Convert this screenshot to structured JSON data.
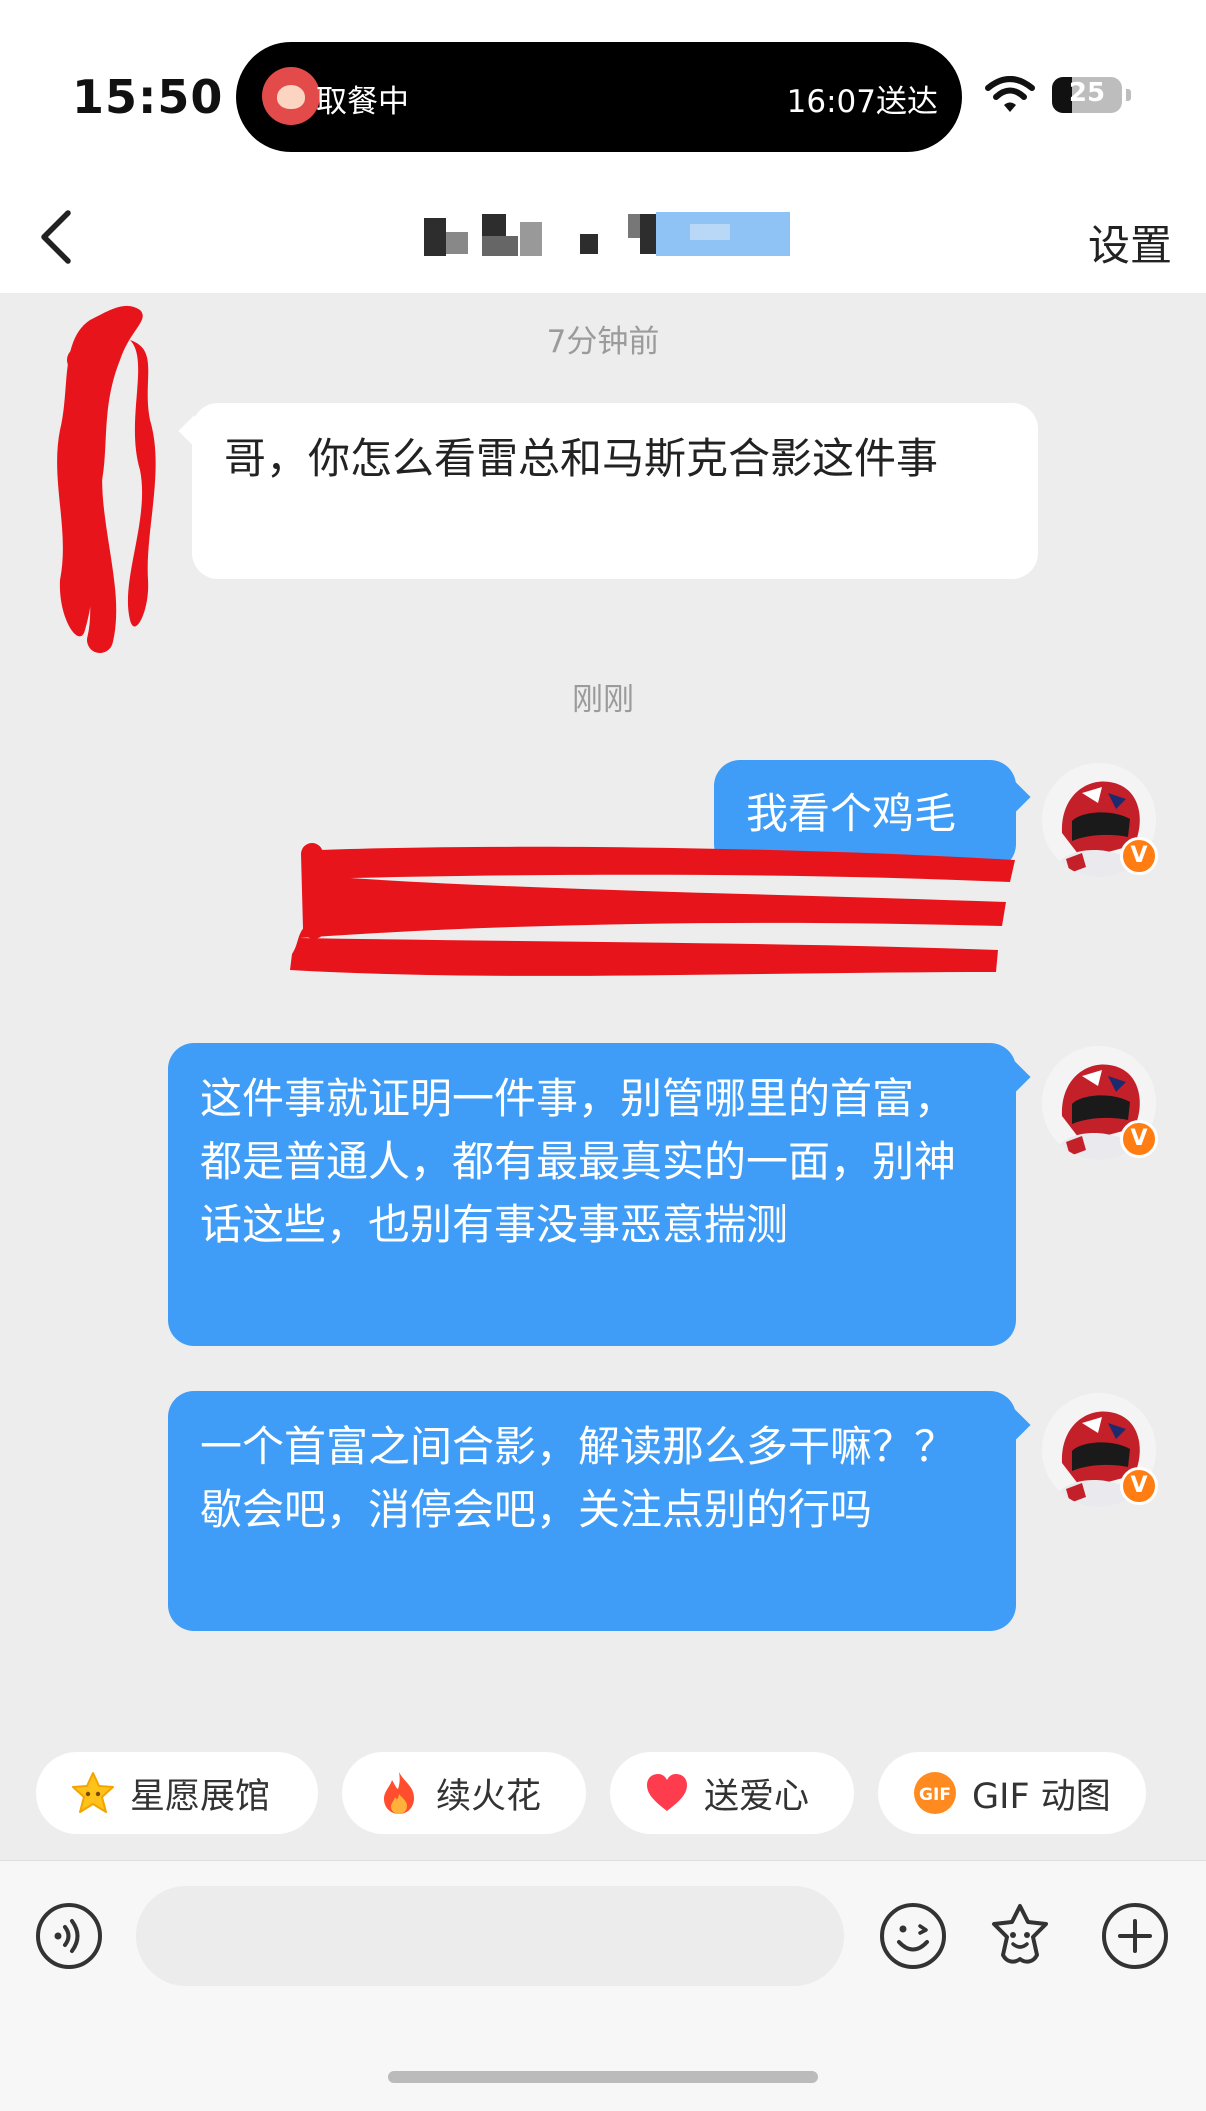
{
  "status_bar": {
    "time": "15:50",
    "live_activity": {
      "left_text": "取餐中",
      "right_text": "16:07送达"
    },
    "battery": "25"
  },
  "header": {
    "back_icon": "chevron-left-icon",
    "settings_label": "设置"
  },
  "messages": [
    {
      "type": "timestamp",
      "text": "7分钟前"
    },
    {
      "type": "incoming",
      "text": "哥，你怎么看雷总和马斯克合影这件事"
    },
    {
      "type": "timestamp",
      "text": "刚刚"
    },
    {
      "type": "outgoing",
      "text": "我看个鸡毛"
    },
    {
      "type": "outgoing",
      "text": "这件事就证明一件事，别管哪里的首富，都是普通人，都有最最真实的一面，别神话这些，也别有事没事恶意揣测"
    },
    {
      "type": "outgoing",
      "text": "一个首富之间合影，解读那么多干嘛？？歇会吧，消停会吧，关注点别的行吗"
    }
  ],
  "quick_actions": [
    {
      "label": "星愿展馆",
      "icon": "star-face-icon"
    },
    {
      "label": "续火花",
      "icon": "fire-icon"
    },
    {
      "label": "送爱心",
      "icon": "heart-icon"
    },
    {
      "label": "GIF 动图",
      "icon": "gif-icon"
    }
  ],
  "input_bar": {
    "placeholder": "",
    "icons": [
      "voice-icon",
      "emoji-icon",
      "sticker-icon",
      "plus-icon"
    ]
  },
  "colors": {
    "outgoing_bubble": "#3f9df7",
    "incoming_bubble": "#ffffff",
    "background": "#ededed",
    "verified_badge": "#ff7d12"
  }
}
